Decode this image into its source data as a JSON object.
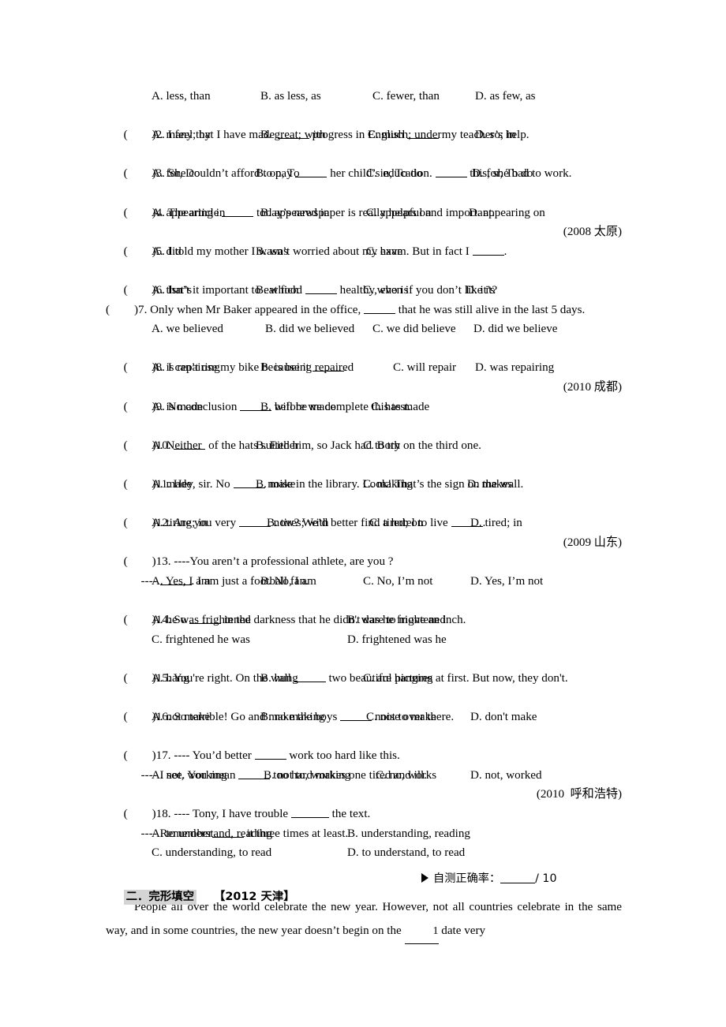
{
  "grammar_section": {
    "first_question_options": {
      "a": "A. less, than",
      "b": "B. as less, as",
      "c": "C. fewer, than",
      "d": "D. as few, as"
    },
    "questions": [
      {
        "num": "2.",
        "text_before": " I feel that I have made ",
        "text_mid": " progress in English ",
        "text_after": " my teacher’s help.",
        "options": [
          "A. many; by",
          "B. great; with",
          "C. much; under",
          "D. so; in"
        ],
        "year": ""
      },
      {
        "num": "3.",
        "text_before": " She couldn’t afford to pay ",
        "text_mid": " her child’s education. ",
        "text_after": " this, she had to work.",
        "options": [
          "A. for, Do",
          "B. on, To",
          "C. in, To do",
          "D. for, To do"
        ],
        "year": ""
      },
      {
        "num": "4.",
        "text_before": " The article ",
        "text_after": " today’s newspaper is really helpful and important.",
        "options": [
          "A. appearing in",
          "B. appeared in",
          "C. appears on",
          "D. appearing on"
        ],
        "year": ""
      },
      {
        "num": "5.",
        "text_before": " I told my mother I wasn’t worried about my exam. But in fact I ",
        "text_after": ".",
        "options": [
          "A. did",
          "B. was",
          "C. have"
        ],
        "year": "(2008 太原)"
      },
      {
        "num": "6.",
        "text_before": " Isn’t it important to eat food ",
        "text_after": " healthy, even if you don’t like it?",
        "options": [
          "A. that’s",
          "B. which",
          "C. who is",
          "D. it’s"
        ],
        "year": ""
      },
      {
        "num": "7.",
        "text_before": " Only when Mr Baker appeared in the office, ",
        "text_after": " that he was still alive in the last 5 days.",
        "options": [
          "A. we believed",
          "B. did we believed",
          "C. we did believe",
          "D. did we believe"
        ],
        "year": ""
      },
      {
        "num": "8.",
        "text_before": " I can’t use my bike because it ",
        "text_after": ".",
        "options": [
          "A. is repairing",
          "B. is being repaired",
          "C. will repair",
          "D. was repairing"
        ],
        "year": ""
      },
      {
        "num": "9.",
        "text_before": " No conclusion ",
        "text_after": " before we complete this test.",
        "options": [
          "A. is made",
          "B. will be made",
          "C. has made"
        ],
        "year": "(2010 成都)"
      },
      {
        "num": "10.",
        "text_before": " ",
        "text_after": " of the hats suited him, so Jack had to try on the third one.",
        "options": [
          "A. Neither",
          "B. Either",
          "C. Both"
        ],
        "year": ""
      },
      {
        "num": "11.",
        "text_before": " Hey, sir. No ",
        "text_after": " noise in the library. Look! That’s the sign on the wall.",
        "options": [
          "A. made",
          "B. make",
          "C. making",
          "D. makes"
        ],
        "year": ""
      },
      {
        "num": "12.",
        "text_before": " Are you very ",
        "text_mid": " now? We’d better find a hotel to live ",
        "text_after": ".",
        "options": [
          "A. tiring; in",
          "B. tires; with",
          "C. tired; on",
          "D. tired; in"
        ],
        "year": ""
      },
      {
        "num": "13.",
        "text_before": " ----You aren’t a professional athlete, are you ?",
        "second_line_before": "---- ",
        "second_line_after": ". I am just a football fan.",
        "options": [
          "A. Yes, I am",
          "B. No, I am",
          "C. No, I’m not",
          "D. Yes, I’m not"
        ],
        "year": "(2009 山东)"
      },
      {
        "num": "14.",
        "text_before": " So ",
        "text_after": " in the darkness that he didn't dare to move an inch.",
        "options_2col": [
          [
            "A. he was frightened",
            "B. was he frightened"
          ],
          [
            "C. frightened he was",
            "D. frightened was he"
          ]
        ],
        "year": ""
      },
      {
        "num": "15.",
        "text_before": " You're right. On the wall ",
        "text_after": " two beautiful pictures at first. But now, they don't.",
        "options": [
          "A. hang",
          "B. hung",
          "C. are hanging"
        ],
        "year": ""
      },
      {
        "num": "16.",
        "text_before": " So terrible! Go and make the boys ",
        "text_after": " noise over there.",
        "options": [
          "A. not make",
          "B. no making",
          "C. not to make",
          "D. don't make"
        ],
        "year": ""
      },
      {
        "num": "17.",
        "text_before": " ---- You’d better ",
        "text_after": " work too hard like this.",
        "second_line_before": "---- I see. You mean ",
        "second_line_after": " too hard makes one tired and ill.",
        "options": [
          "A. not, working",
          "B. not to, working",
          "C. no, works",
          "D. not, worked"
        ],
        "year": ""
      },
      {
        "num": "18.",
        "text_before": " ---- Tony, I have trouble ",
        "text_after": " the text.",
        "second_line_before": "---- Remember",
        "second_line_after": " it three times at least.",
        "options_2col": [
          [
            "A. to understand, reading",
            "B. understanding, reading"
          ],
          [
            "C. understanding, to read",
            "D. to understand, to read"
          ]
        ],
        "year": "(2010  呼和浩特)"
      }
    ]
  },
  "cloze_section": {
    "heading": "二．完形填空",
    "source": "【2012 天津】",
    "selftest_label": "自测正确率：",
    "selftest_total": "/ 10",
    "passage_part1": "People all over the world celebrate the new year. However, not all countries celebrate in the same way, and in some countries, the new year doesn’t begin on the ",
    "passage_blank_num": "1",
    "passage_part2": " date very"
  },
  "colors": {
    "highlight": "#d4d4d4",
    "text": "#000000",
    "page_background": "#ffffff"
  }
}
